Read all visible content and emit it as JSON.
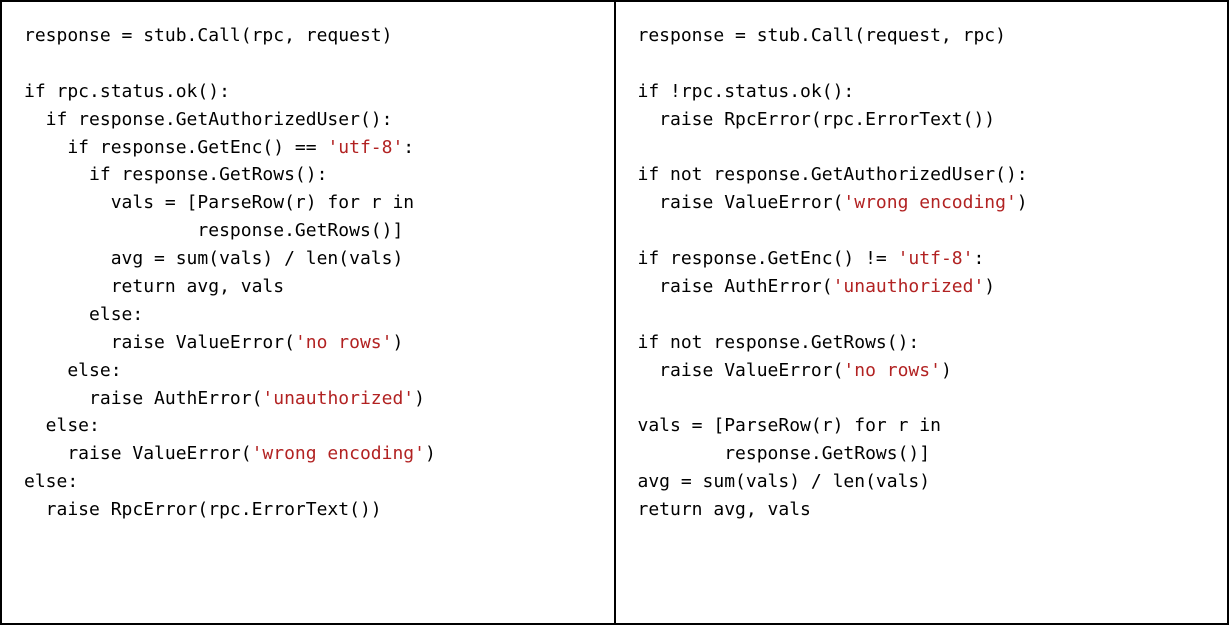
{
  "left": {
    "l01": "response = stub.Call(rpc, request)",
    "l02": "",
    "l03": "if rpc.status.ok():",
    "l04": "  if response.GetAuthorizedUser():",
    "l05a": "    if response.GetEnc() == ",
    "l05s": "'utf-8'",
    "l05b": ":",
    "l06": "      if response.GetRows():",
    "l07": "        vals = [ParseRow(r) for r in",
    "l08": "                response.GetRows()]",
    "l09": "        avg = sum(vals) / len(vals)",
    "l10": "        return avg, vals",
    "l11": "      else:",
    "l12a": "        raise ValueError(",
    "l12s": "'no rows'",
    "l12b": ")",
    "l13": "    else:",
    "l14a": "      raise AuthError(",
    "l14s": "'unauthorized'",
    "l14b": ")",
    "l15": "  else:",
    "l16a": "    raise ValueError(",
    "l16s": "'wrong encoding'",
    "l16b": ")",
    "l17": "else:",
    "l18": "  raise RpcError(rpc.ErrorText())"
  },
  "right": {
    "r01": "response = stub.Call(request, rpc)",
    "r02": "",
    "r03": "if !rpc.status.ok():",
    "r04": "  raise RpcError(rpc.ErrorText())",
    "r05": "",
    "r06": "if not response.GetAuthorizedUser():",
    "r07a": "  raise ValueError(",
    "r07s": "'wrong encoding'",
    "r07b": ")",
    "r08": "",
    "r09a": "if response.GetEnc() != ",
    "r09s": "'utf-8'",
    "r09b": ":",
    "r10a": "  raise AuthError(",
    "r10s": "'unauthorized'",
    "r10b": ")",
    "r11": "",
    "r12": "if not response.GetRows():",
    "r13a": "  raise ValueError(",
    "r13s": "'no rows'",
    "r13b": ")",
    "r14": "",
    "r15": "vals = [ParseRow(r) for r in",
    "r16": "        response.GetRows()]",
    "r17": "avg = sum(vals) / len(vals)",
    "r18": "return avg, vals"
  }
}
